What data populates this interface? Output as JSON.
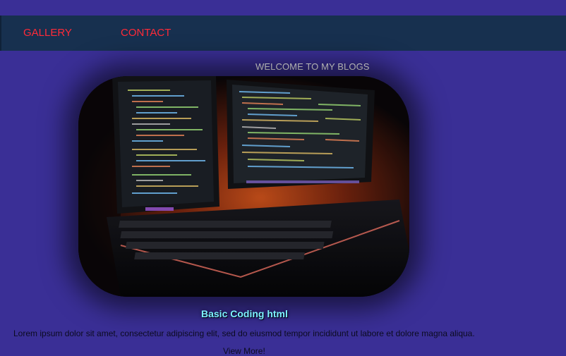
{
  "nav": {
    "items": [
      {
        "label": "GALLERY"
      },
      {
        "label": "CONTACT"
      }
    ]
  },
  "hero": {
    "heading": "WELCOME TO MY BLOGS",
    "image_icon": "coding-setup-photo"
  },
  "post": {
    "title": "Basic Coding html",
    "excerpt": "Lorem ipsum dolor sit amet, consectetur adipiscing elit, sed do eiusmod tempor incididunt ut labore et dolore magna aliqua.",
    "link_label": "View More!"
  },
  "colors": {
    "background": "#3a2f96",
    "nav_background": "#17304f",
    "nav_link": "#ff2a38",
    "post_title": "#7cf1ff"
  }
}
